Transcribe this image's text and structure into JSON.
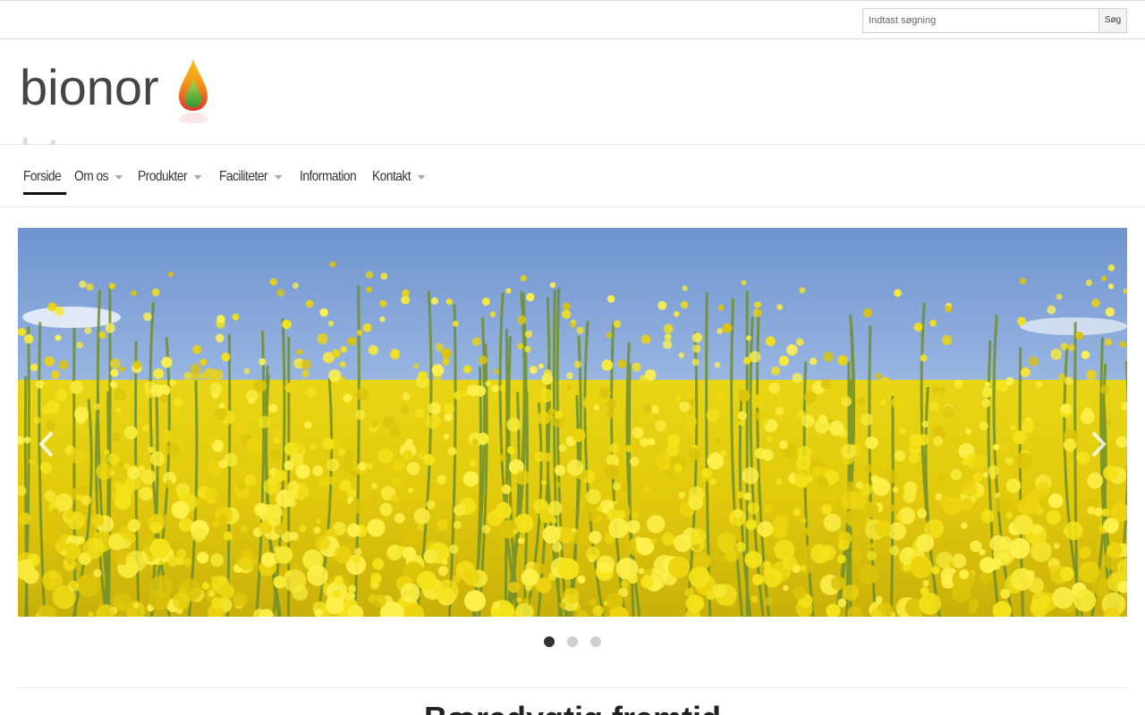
{
  "search": {
    "placeholder": "Indtast søgning",
    "button_label": "Søg"
  },
  "logo": {
    "text": "bionor",
    "icon": "oil-drop-icon"
  },
  "nav": {
    "items": [
      {
        "label": "Forside",
        "active": true,
        "has_submenu": false
      },
      {
        "label": "Om os",
        "active": false,
        "has_submenu": true
      },
      {
        "label": "Produkter",
        "active": false,
        "has_submenu": true
      },
      {
        "label": "Faciliteter",
        "active": false,
        "has_submenu": true
      },
      {
        "label": "Information",
        "active": false,
        "has_submenu": false
      },
      {
        "label": "Kontakt",
        "active": false,
        "has_submenu": true
      }
    ]
  },
  "slider": {
    "slide_count": 3,
    "active_slide": 1,
    "prev_icon": "chevron-left-icon",
    "next_icon": "chevron-right-icon"
  },
  "main": {
    "section_title": "Bæredygtig fremtid"
  },
  "colors": {
    "accent": "#111111",
    "drop_top": "#f6a01a",
    "drop_bottom": "#3aa935",
    "drop_red": "#e0352a"
  }
}
